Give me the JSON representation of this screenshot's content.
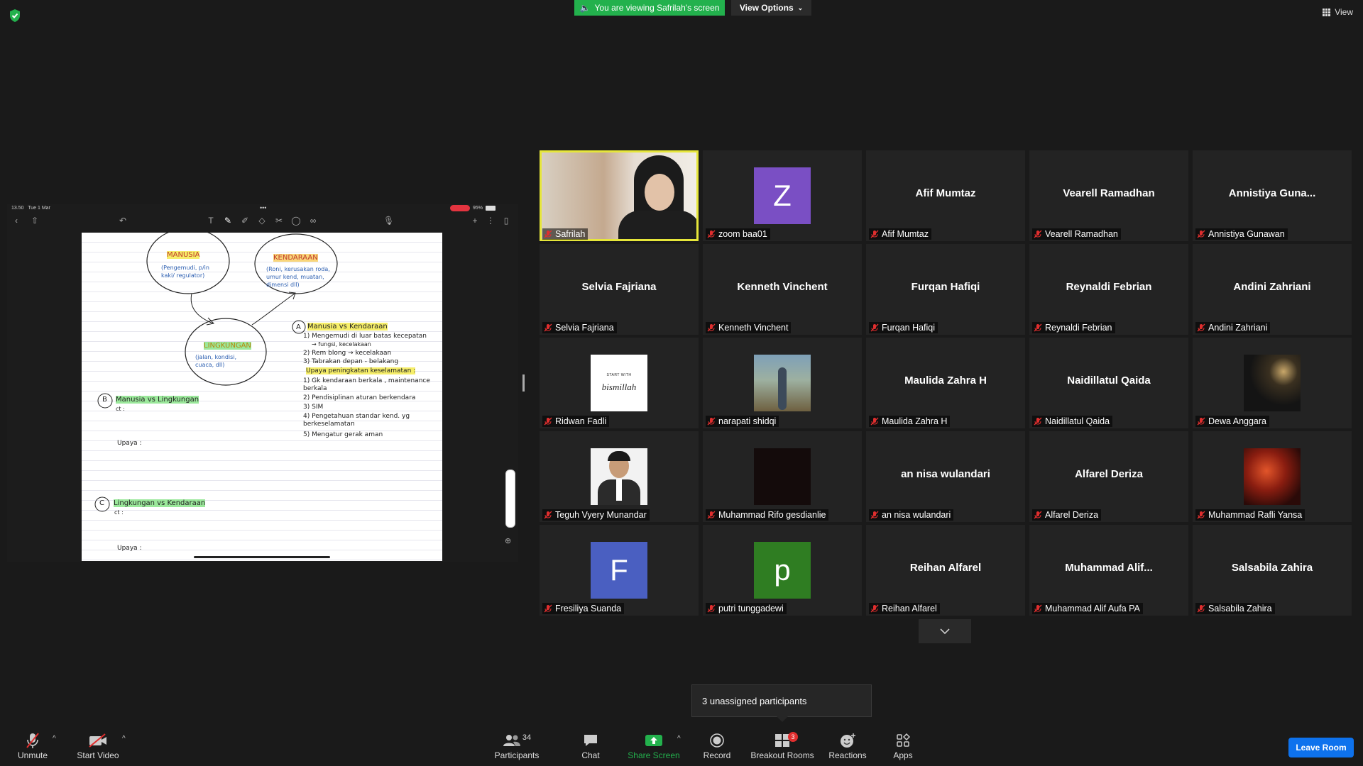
{
  "top": {
    "banner": "You are viewing Safrilah's screen",
    "view_options": "View Options",
    "view": "View"
  },
  "shared_screen": {
    "status_time": "13.50",
    "status_date": "Tue 1 Mar",
    "battery": "95%",
    "notes": {
      "manusia": "MANUSIA",
      "manusia_sub": "(Pengemudi, p/in kaki/ regulator)",
      "kendaraan": "KENDARAAN",
      "kendaraan_sub": "(Roni, kerusakan roda, umur kend, muatan, dimensi dll)",
      "lingkungan": "LINGKUNGAN",
      "lingkungan_sub": "(jalan, kondisi, cuaca, dll)",
      "a_title": "Manusia vs Kendaraan",
      "a1": "Mengemudi di luar batas kecepatan",
      "a1b": "→ fungsi, kecelakaan",
      "a2": "Rem blong → kecelakaan",
      "a3": "Tabrakan depan - belakang",
      "a_upaya": "Upaya peningkatan keselamatan :",
      "u1": "Gk kendaraan berkala , maintenance berkala",
      "u2": "Pendisiplinan aturan berkendara",
      "u3": "SIM",
      "u4": "Pengetahuan standar kend. yg berkeselamatan",
      "u5": "Mengatur gerak aman",
      "b_title": "Manusia vs Lingkungan",
      "ct": "ct :",
      "upaya": "Upaya :",
      "c_title": "Lingkungan vs Kendaraan"
    }
  },
  "participants_grid": [
    {
      "name": "Safrilah",
      "type": "video-photo",
      "active": true
    },
    {
      "name": "zoom baa01",
      "type": "letter",
      "letter": "Z",
      "color": "#7a4fc4"
    },
    {
      "name": "Afif Mumtaz",
      "type": "name",
      "display": "Afif Mumtaz"
    },
    {
      "name": "Vearell Ramadhan",
      "type": "name",
      "display": "Vearell Ramadhan"
    },
    {
      "name": "Annistiya Gunawan",
      "type": "name",
      "display": "Annistiya  Guna..."
    },
    {
      "name": "Selvia Fajriana",
      "type": "name",
      "display": "Selvia Fajriana"
    },
    {
      "name": "Kenneth Vinchent",
      "type": "name",
      "display": "Kenneth Vinchent"
    },
    {
      "name": "Furqan Hafiqi",
      "type": "name",
      "display": "Furqan Hafiqi"
    },
    {
      "name": "Reynaldi Febrian",
      "type": "name",
      "display": "Reynaldi Febrian"
    },
    {
      "name": "Andini Zahriani",
      "type": "name",
      "display": "Andini Zahriani"
    },
    {
      "name": "Ridwan Fadli",
      "type": "photo-bismillah",
      "photo_text_top": "START WITH",
      "photo_text": "bismillah"
    },
    {
      "name": "narapati shidqi",
      "type": "photo-outdoor"
    },
    {
      "name": "Maulida Zahra H",
      "type": "name",
      "display": "Maulida Zahra H"
    },
    {
      "name": "Naidillatul Qaida",
      "type": "name",
      "display": "Naidillatul Qaida"
    },
    {
      "name": "Dewa Anggara",
      "type": "photo-night"
    },
    {
      "name": "Teguh Vyery Munandar",
      "type": "photo-portrait"
    },
    {
      "name": "Muhammad Rifo gesdianlie",
      "type": "photo-dark"
    },
    {
      "name": "an nisa wulandari",
      "type": "name",
      "display": "an nisa wulandari"
    },
    {
      "name": "Alfarel Deriza",
      "type": "name",
      "display": "Alfarel Deriza"
    },
    {
      "name": "Muhammad Rafli Yansa",
      "type": "photo-red"
    },
    {
      "name": "Fresiliya Suanda",
      "type": "letter",
      "letter": "F",
      "color": "#4a5fc1"
    },
    {
      "name": "putri tunggadewi",
      "type": "letter",
      "letter": "p",
      "color": "#2f7d22"
    },
    {
      "name": "Reihan Alfarel",
      "type": "name",
      "display": "Reihan Alfarel"
    },
    {
      "name": "Muhammad Alif Aufa PA",
      "type": "name",
      "display": "Muhammad  Alif..."
    },
    {
      "name": "Salsabila Zahira",
      "type": "name",
      "display": "Salsabila Zahira"
    }
  ],
  "tooltip": "3 unassigned participants",
  "toolbar": {
    "unmute": "Unmute",
    "start_video": "Start Video",
    "participants": "Participants",
    "participants_count": "34",
    "chat": "Chat",
    "share_screen": "Share Screen",
    "record": "Record",
    "breakout_rooms": "Breakout Rooms",
    "breakout_badge": "3",
    "reactions": "Reactions",
    "apps": "Apps",
    "leave_room": "Leave Room"
  },
  "colors": {
    "share_green": "#23b14d",
    "leave_blue": "#0e72ed",
    "active_speaker": "#e6e63a",
    "muted_red": "#e02e2e"
  }
}
